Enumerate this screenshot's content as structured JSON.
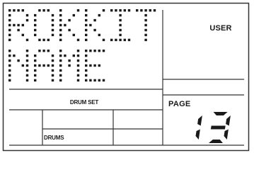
{
  "display": {
    "kit_name_line1": "ROKKIT",
    "kit_name_line2": "NAME",
    "mode_label": "USER",
    "drum_set_label": "DRUM SET",
    "drums_label": "DRUMS",
    "page_label": "PAGE",
    "page_number": "13"
  },
  "colors": {
    "segment": "#1a1a1a",
    "frame": "#333333",
    "background": "#ffffff"
  }
}
